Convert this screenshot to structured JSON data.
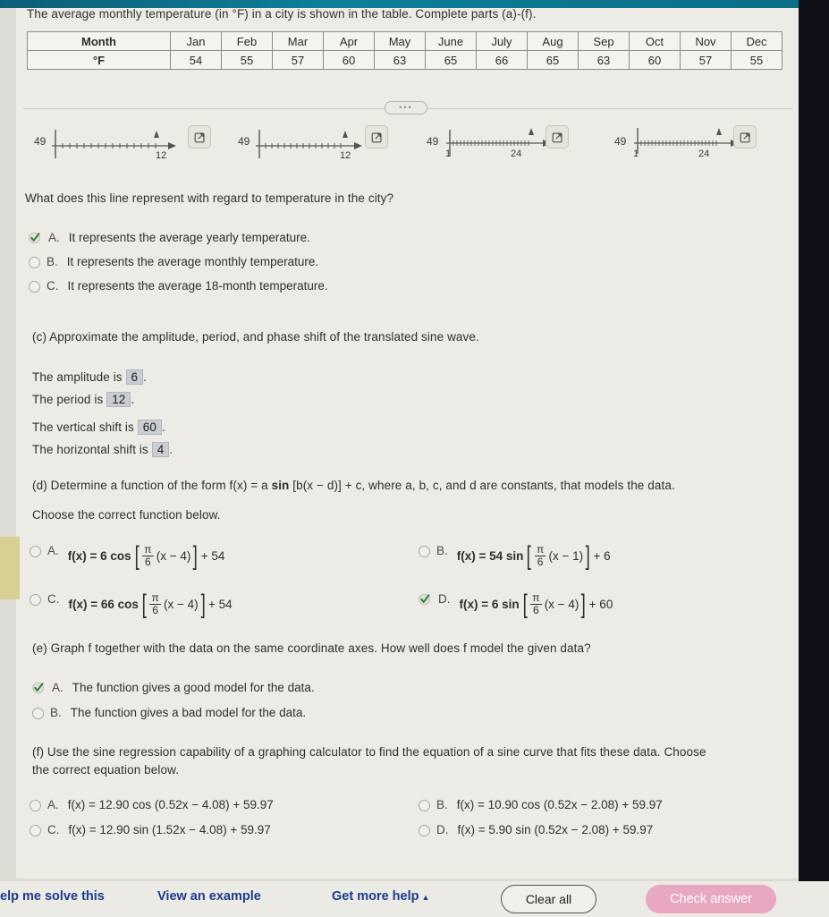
{
  "intro": "The average monthly temperature (in °F) in a city is shown in the table. Complete parts (a)-(f).",
  "table": {
    "row_headers": [
      "Month",
      "°F"
    ],
    "months": [
      "Jan",
      "Feb",
      "Mar",
      "Apr",
      "May",
      "June",
      "July",
      "Aug",
      "Sep",
      "Oct",
      "Nov",
      "Dec"
    ],
    "temperatures": [
      54,
      55,
      57,
      60,
      63,
      65,
      66,
      65,
      63,
      60,
      57,
      55
    ]
  },
  "divider": {
    "handle": "•••"
  },
  "graphs": [
    {
      "y_label": "49",
      "x_left": "",
      "x_right": "12",
      "expand_icon": "expand-icon"
    },
    {
      "y_label": "49",
      "x_left": "",
      "x_right": "12",
      "expand_icon": "expand-icon"
    },
    {
      "y_label": "49",
      "x_left": "1",
      "x_right": "24",
      "expand_icon": "expand-icon"
    },
    {
      "y_label": "49",
      "x_left": "1",
      "x_right": "24",
      "expand_icon": "expand-icon"
    }
  ],
  "part_b": {
    "question": "What does this line represent with regard to temperature in the city?",
    "options": [
      {
        "label": "A.",
        "text": "It represents the average yearly temperature.",
        "selected": true
      },
      {
        "label": "B.",
        "text": "It represents the average monthly temperature.",
        "selected": false
      },
      {
        "label": "C.",
        "text": "It represents the average 18-month temperature.",
        "selected": false
      }
    ]
  },
  "part_c": {
    "prompt": "(c) Approximate the amplitude, period, and phase shift of the translated sine wave.",
    "fields": [
      {
        "prefix": "The amplitude is",
        "value": "6",
        "suffix": "."
      },
      {
        "prefix": "The period is",
        "value": "12",
        "suffix": "."
      },
      {
        "prefix": "The vertical shift is",
        "value": "60",
        "suffix": "."
      },
      {
        "prefix": "The horizontal shift is",
        "value": "4",
        "suffix": "."
      }
    ]
  },
  "part_d": {
    "prompt_pre": "(d) Determine a function of the form f(x) = a ",
    "prompt_fn": "sin",
    "prompt_post": " [b(x − d)] + c, where a, b, c, and d are constants, that models the data.",
    "choose": "Choose the correct function below.",
    "options": [
      {
        "label": "A.",
        "lead": "f(x) = 6 cos",
        "num": "π",
        "den": "6",
        "inner": "(x − 4)",
        "tail": "+ 54",
        "selected": false
      },
      {
        "label": "B.",
        "lead": "f(x) = 54 sin",
        "num": "π",
        "den": "6",
        "inner": "(x − 1)",
        "tail": "+ 6",
        "selected": false
      },
      {
        "label": "C.",
        "lead": "f(x) = 66 cos",
        "num": "π",
        "den": "6",
        "inner": "(x − 4)",
        "tail": "+ 54",
        "selected": false
      },
      {
        "label": "D.",
        "lead": "f(x) = 6 sin",
        "num": "π",
        "den": "6",
        "inner": "(x − 4)",
        "tail": "+ 60",
        "selected": true
      }
    ]
  },
  "part_e": {
    "prompt": "(e) Graph f together with the data on the same coordinate axes. How well does f model the given data?",
    "options": [
      {
        "label": "A.",
        "text": "The function gives a good model for the data.",
        "selected": true
      },
      {
        "label": "B.",
        "text": "The function gives a bad model for the data.",
        "selected": false
      }
    ]
  },
  "part_f": {
    "prompt_line1": "(f) Use the sine regression capability of a graphing calculator to find the equation of a sine curve that fits these data. Choose",
    "prompt_line2": "the correct equation below.",
    "options": [
      {
        "label": "A.",
        "text": "f(x) = 12.90 cos (0.52x − 4.08) + 59.97",
        "selected": false
      },
      {
        "label": "B.",
        "text": "f(x) = 10.90 cos (0.52x − 2.08) + 59.97",
        "selected": false
      },
      {
        "label": "C.",
        "text": "f(x) = 12.90 sin (1.52x − 4.08) + 59.97",
        "selected": false
      },
      {
        "label": "D.",
        "text": "f(x) = 5.90 sin (0.52x − 2.08) + 59.97",
        "selected": false
      }
    ]
  },
  "bottom_bar": {
    "help_me_solve": "elp me solve this",
    "view_example": "View an example",
    "get_more_help": "Get more help",
    "get_more_help_caret": "▲",
    "clear_all": "Clear all",
    "check_answer": "Check answer"
  },
  "colors": {
    "accent_teal": "#0e7f9b",
    "link_blue": "#1a3c8f",
    "check_pink": "#e9a8c1",
    "answer_box": "#c9cdd4",
    "checkmark_green": "#2e7d32"
  }
}
